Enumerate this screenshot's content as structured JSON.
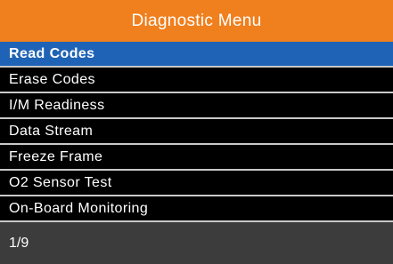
{
  "header": {
    "title": "Diagnostic Menu"
  },
  "menu": {
    "items": [
      {
        "label": "Read Codes",
        "selected": true
      },
      {
        "label": "Erase Codes",
        "selected": false
      },
      {
        "label": "I/M Readiness",
        "selected": false
      },
      {
        "label": "Data Stream",
        "selected": false
      },
      {
        "label": "Freeze Frame",
        "selected": false
      },
      {
        "label": "O2 Sensor Test",
        "selected": false
      },
      {
        "label": "On-Board Monitoring",
        "selected": false
      }
    ]
  },
  "status": {
    "page_indicator": "1/9"
  },
  "colors": {
    "header_bg": "#f07f1d",
    "selected_bg": "#1f63b6",
    "list_bg": "#000000",
    "status_bg": "#3c3c3c",
    "text": "#ffffff",
    "divider": "#c8c8c8"
  }
}
